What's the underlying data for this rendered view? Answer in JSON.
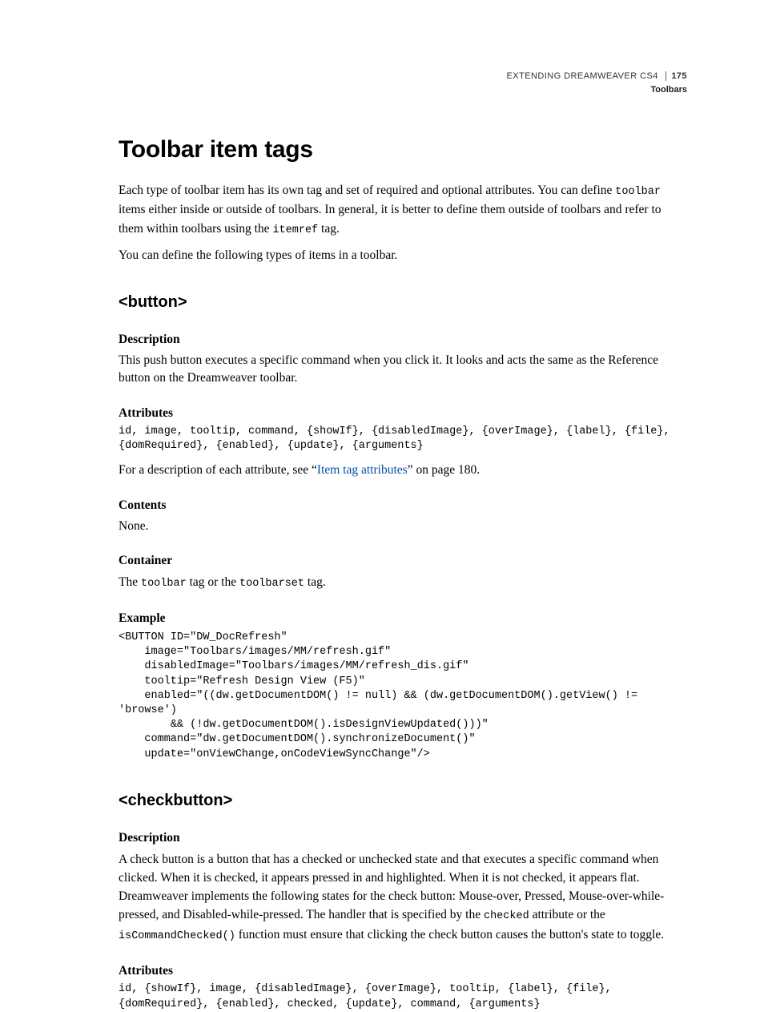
{
  "header": {
    "book_title": "EXTENDING DREAMWEAVER CS4",
    "section": "Toolbars",
    "page_number": "175"
  },
  "title": "Toolbar item tags",
  "intro": {
    "p1_a": "Each type of toolbar item has its own tag and set of required and optional attributes. You can define ",
    "p1_code1": "toolbar",
    "p1_b": " items either inside or outside of toolbars. In general, it is better to define them outside of toolbars and refer to them within toolbars using the ",
    "p1_code2": "itemref",
    "p1_c": " tag.",
    "p2": "You can define the following types of items in a toolbar."
  },
  "button": {
    "heading": "<button>",
    "desc_label": "Description",
    "desc_text": "This push button executes a specific command when you click it. It looks and acts the same as the Reference button on the Dreamweaver toolbar.",
    "attr_label": "Attributes",
    "attr_code": "id, image, tooltip, command, {showIf}, {disabledImage}, {overImage}, {label}, {file}, {domRequired}, {enabled}, {update}, {arguments}",
    "attr_after_a": "For a description of each attribute, see “",
    "attr_link": "Item tag attributes",
    "attr_after_b": "” on page 180.",
    "contents_label": "Contents",
    "contents_text": "None.",
    "container_label": "Container",
    "container_a": "The ",
    "container_code1": "toolbar",
    "container_b": " tag or the ",
    "container_code2": "toolbarset",
    "container_c": " tag.",
    "example_label": "Example",
    "example_code": "<BUTTON ID=\"DW_DocRefresh\"\n    image=\"Toolbars/images/MM/refresh.gif\"\n    disabledImage=\"Toolbars/images/MM/refresh_dis.gif\"\n    tooltip=\"Refresh Design View (F5)\"\n    enabled=\"((dw.getDocumentDOM() != null) && (dw.getDocumentDOM().getView() != 'browse')\n        && (!dw.getDocumentDOM().isDesignViewUpdated()))\"\n    command=\"dw.getDocumentDOM().synchronizeDocument()\"\n    update=\"onViewChange,onCodeViewSyncChange\"/>"
  },
  "checkbutton": {
    "heading": "<checkbutton>",
    "desc_label": "Description",
    "desc_a": "A check button is a button that has a checked or unchecked state and that executes a specific command when clicked. When it is checked, it appears pressed in and highlighted. When it is not checked, it appears flat. Dreamweaver implements the following states for the check button: Mouse-over, Pressed, Mouse-over-while-pressed, and Disabled-while-pressed. The handler that is specified by the ",
    "desc_code1": "checked",
    "desc_b": " attribute or the ",
    "desc_code2": "isCommandChecked()",
    "desc_c": " function must ensure that clicking the check button causes the button's state to toggle.",
    "attr_label": "Attributes",
    "attr_code": "id, {showIf}, image, {disabledImage}, {overImage}, tooltip, {label}, {file}, {domRequired}, {enabled}, checked, {update}, command, {arguments}"
  }
}
